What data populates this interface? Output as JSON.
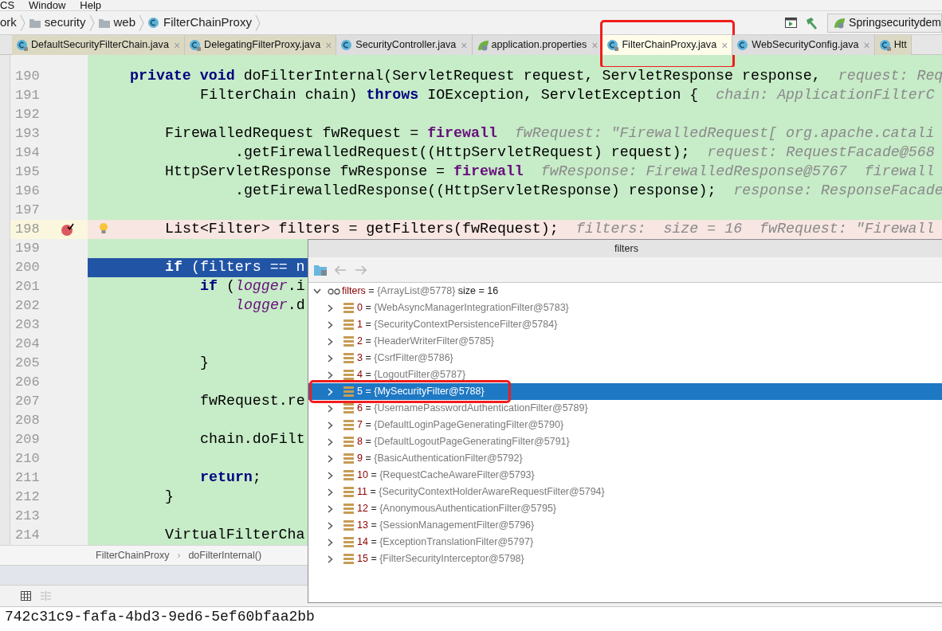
{
  "menu": [
    "CS",
    "Window",
    "Help"
  ],
  "breadcrumb": [
    {
      "kind": "text",
      "label": "ork"
    },
    {
      "kind": "folder",
      "label": "security"
    },
    {
      "kind": "folder",
      "label": "web"
    },
    {
      "kind": "class",
      "label": "FilterChainProxy"
    }
  ],
  "run_config": "Springsecuritydem",
  "tabs": [
    {
      "label": "DefaultSecurityFilterChain.java",
      "kind": "library",
      "selected": false,
      "outlined": false,
      "close": "×"
    },
    {
      "label": "DelegatingFilterProxy.java",
      "kind": "library",
      "selected": false,
      "outlined": false,
      "close": "×"
    },
    {
      "label": "SecurityController.java",
      "kind": "class",
      "selected": false,
      "outlined": false,
      "close": "×"
    },
    {
      "label": "application.properties",
      "kind": "properties",
      "selected": false,
      "outlined": false,
      "close": "×"
    },
    {
      "label": "FilterChainProxy.java",
      "kind": "library",
      "selected": true,
      "outlined": true,
      "close": "×"
    },
    {
      "label": "WebSecurityConfig.java",
      "kind": "class",
      "selected": false,
      "outlined": false,
      "close": "×"
    },
    {
      "label": "Htt",
      "kind": "library",
      "selected": false,
      "outlined": false
    }
  ],
  "editor": {
    "lines": [
      {
        "number": "190",
        "kind": "plain",
        "tokens": [
          {
            "kind": "kw",
            "text": "    private"
          },
          {
            "kind": "kw",
            "text": " void"
          },
          {
            "kind": "plain",
            "text": " doFilterInternal(ServletRequest request, ServletResponse response,"
          }
        ],
        "hint": "request: Req"
      },
      {
        "number": "191",
        "kind": "plain",
        "tokens": [
          {
            "kind": "plain",
            "text": "            FilterChain chain) "
          },
          {
            "kind": "kw",
            "text": "throws"
          },
          {
            "kind": "plain",
            "text": " IOException, ServletException {"
          }
        ],
        "hint": "chain: ApplicationFilterC"
      },
      {
        "number": "192",
        "kind": "plain"
      },
      {
        "number": "193",
        "kind": "plain",
        "tokens": [
          {
            "kind": "plain",
            "text": "        FirewalledRequest fwRequest = "
          },
          {
            "kind": "field",
            "text": "firewall"
          }
        ],
        "hint": "fwRequest: \"FirewalledRequest[ org.apache.catali"
      },
      {
        "number": "194",
        "kind": "plain",
        "tokens": [
          {
            "kind": "plain",
            "text": "                .getFirewalledRequest((HttpServletRequest) request);"
          }
        ],
        "hint": "request: RequestFacade@568"
      },
      {
        "number": "195",
        "kind": "plain",
        "tokens": [
          {
            "kind": "plain",
            "text": "        HttpServletResponse fwResponse = "
          },
          {
            "kind": "field",
            "text": "firewall"
          }
        ],
        "hint": "fwResponse: FirewalledResponse@5767  firewall"
      },
      {
        "number": "196",
        "kind": "plain",
        "tokens": [
          {
            "kind": "plain",
            "text": "                .getFirewalledResponse((HttpServletResponse) response);"
          }
        ],
        "hint": "response: ResponseFacade"
      },
      {
        "number": "197",
        "kind": "plain"
      },
      {
        "number": "198",
        "kind": "breakpoint",
        "tokens": [
          {
            "kind": "plain",
            "text": "        List<Filter> filters = getFilters(fwRequest);"
          }
        ],
        "hint": "filters:  size = 16  fwRequest: \"Firewall"
      },
      {
        "number": "199",
        "kind": "plain"
      },
      {
        "number": "200",
        "kind": "current",
        "tokens": [
          {
            "kind": "kw",
            "text": "        if"
          },
          {
            "kind": "plain",
            "text": " (filters == n"
          }
        ]
      },
      {
        "number": "201",
        "kind": "plain",
        "tokens": [
          {
            "kind": "kw",
            "text": "            if"
          },
          {
            "kind": "plain",
            "text": " ("
          },
          {
            "kind": "static",
            "text": "logger"
          },
          {
            "kind": "plain",
            "text": ".i"
          }
        ]
      },
      {
        "number": "202",
        "kind": "plain",
        "tokens": [
          {
            "kind": "static",
            "text": "                logger"
          },
          {
            "kind": "plain",
            "text": ".d"
          }
        ]
      },
      {
        "number": "203",
        "kind": "plain"
      },
      {
        "number": "204",
        "kind": "plain"
      },
      {
        "number": "205",
        "kind": "plain",
        "tokens": [
          {
            "kind": "plain",
            "text": "            }"
          }
        ]
      },
      {
        "number": "206",
        "kind": "plain"
      },
      {
        "number": "207",
        "kind": "plain",
        "tokens": [
          {
            "kind": "plain",
            "text": "            fwRequest.re"
          }
        ]
      },
      {
        "number": "208",
        "kind": "plain"
      },
      {
        "number": "209",
        "kind": "plain",
        "tokens": [
          {
            "kind": "plain",
            "text": "            chain.doFilt"
          }
        ]
      },
      {
        "number": "210",
        "kind": "plain"
      },
      {
        "number": "211",
        "kind": "plain",
        "tokens": [
          {
            "kind": "kw",
            "text": "            return"
          },
          {
            "kind": "plain",
            "text": ";"
          }
        ]
      },
      {
        "number": "212",
        "kind": "plain",
        "tokens": [
          {
            "kind": "plain",
            "text": "        }"
          }
        ]
      },
      {
        "number": "213",
        "kind": "plain"
      },
      {
        "number": "214",
        "kind": "plain",
        "tokens": [
          {
            "kind": "plain",
            "text": "        VirtualFilterCha"
          }
        ]
      }
    ]
  },
  "editor_crumbs": [
    {
      "label": "FilterChainProxy"
    },
    {
      "separator": "›",
      "label": "doFilterInternal()"
    }
  ],
  "console_line": "742c31c9-fafa-4bd3-9ed6-5ef60bfaa2bb",
  "popup": {
    "title": "filters",
    "root": {
      "name": "filters",
      "operator": "=",
      "value": "{ArrayList@5778}",
      "extra": "size = 16",
      "expanded": true
    },
    "items": [
      {
        "index": "0",
        "operator": "=",
        "value": "{WebAsyncManagerIntegrationFilter@5783}",
        "selected": false,
        "outlined": false
      },
      {
        "index": "1",
        "operator": "=",
        "value": "{SecurityContextPersistenceFilter@5784}",
        "selected": false,
        "outlined": false
      },
      {
        "index": "2",
        "operator": "=",
        "value": "{HeaderWriterFilter@5785}",
        "selected": false,
        "outlined": false
      },
      {
        "index": "3",
        "operator": "=",
        "value": "{CsrfFilter@5786}",
        "selected": false,
        "outlined": false
      },
      {
        "index": "4",
        "operator": "=",
        "value": "{LogoutFilter@5787}",
        "selected": false,
        "outlined": false
      },
      {
        "index": "5",
        "operator": "=",
        "value": "{MySecurityFilter@5788}",
        "selected": true,
        "outlined": true
      },
      {
        "index": "6",
        "operator": "=",
        "value": "{UsernamePasswordAuthenticationFilter@5789}",
        "selected": false,
        "outlined": false
      },
      {
        "index": "7",
        "operator": "=",
        "value": "{DefaultLoginPageGeneratingFilter@5790}",
        "selected": false,
        "outlined": false
      },
      {
        "index": "8",
        "operator": "=",
        "value": "{DefaultLogoutPageGeneratingFilter@5791}",
        "selected": false,
        "outlined": false
      },
      {
        "index": "9",
        "operator": "=",
        "value": "{BasicAuthenticationFilter@5792}",
        "selected": false,
        "outlined": false
      },
      {
        "index": "10",
        "operator": "=",
        "value": "{RequestCacheAwareFilter@5793}",
        "selected": false,
        "outlined": false
      },
      {
        "index": "11",
        "operator": "=",
        "value": "{SecurityContextHolderAwareRequestFilter@5794}",
        "selected": false,
        "outlined": false
      },
      {
        "index": "12",
        "operator": "=",
        "value": "{AnonymousAuthenticationFilter@5795}",
        "selected": false,
        "outlined": false
      },
      {
        "index": "13",
        "operator": "=",
        "value": "{SessionManagementFilter@5796}",
        "selected": false,
        "outlined": false
      },
      {
        "index": "14",
        "operator": "=",
        "value": "{ExceptionTranslationFilter@5797}",
        "selected": false,
        "outlined": false
      },
      {
        "index": "15",
        "operator": "=",
        "value": "{FilterSecurityInterceptor@5798}",
        "selected": false,
        "outlined": false
      }
    ]
  }
}
